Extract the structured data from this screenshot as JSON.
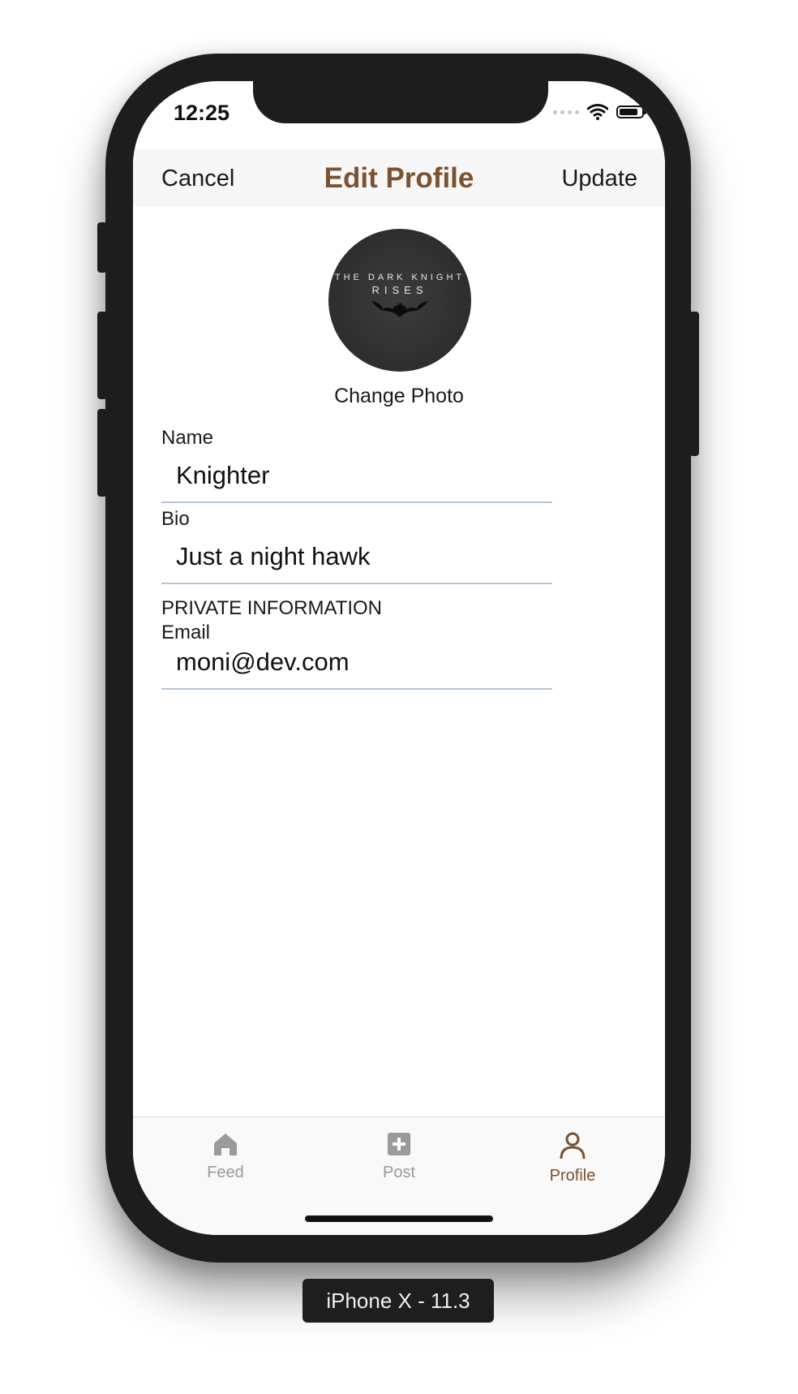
{
  "status_bar": {
    "time": "12:25"
  },
  "navbar": {
    "cancel_label": "Cancel",
    "title": "Edit Profile",
    "update_label": "Update"
  },
  "avatar": {
    "line1": "THE DARK KNIGHT",
    "line2": "RISES"
  },
  "change_photo_label": "Change Photo",
  "form": {
    "name_label": "Name",
    "name_value": "Knighter",
    "bio_label": "Bio",
    "bio_value": "Just a night hawk",
    "private_header": "PRIVATE INFORMATION",
    "email_label": "Email",
    "email_value": "moni@dev.com"
  },
  "tabbar": {
    "items": [
      {
        "label": "Feed",
        "icon": "home-icon",
        "active": false
      },
      {
        "label": "Post",
        "icon": "add-post-icon",
        "active": false
      },
      {
        "label": "Profile",
        "icon": "profile-icon",
        "active": true
      }
    ]
  },
  "device_label": "iPhone X - 11.3",
  "colors": {
    "accent": "#7a5230",
    "inactive": "#9a9a9a",
    "underline": "#b7c6d6"
  }
}
